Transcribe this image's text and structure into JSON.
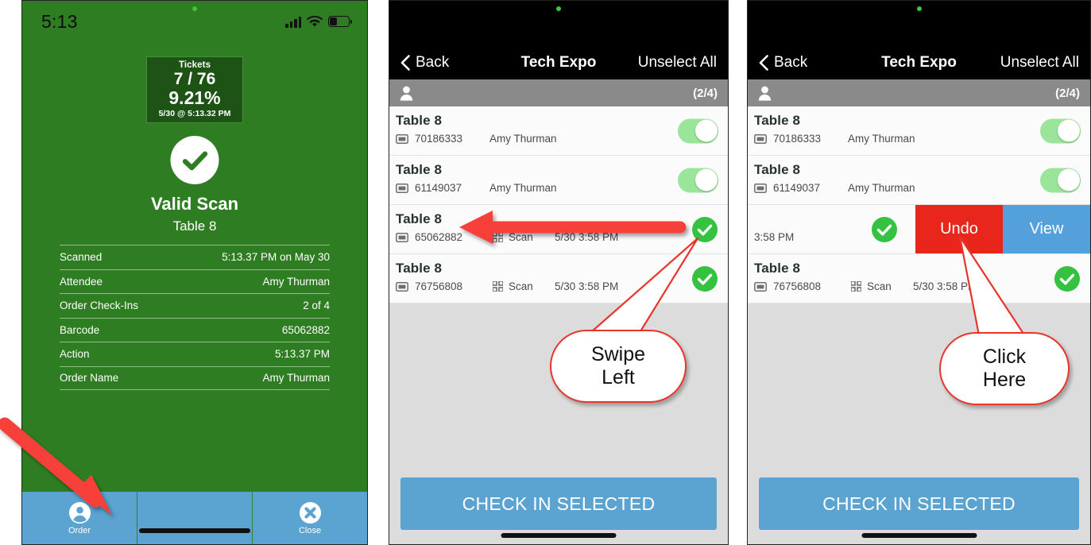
{
  "panel1": {
    "status": {
      "time": "5:13",
      "icons": [
        "cellular-icon",
        "wifi-icon",
        "battery-icon"
      ]
    },
    "ticket_box": {
      "label": "Tickets",
      "count": "7 / 76",
      "percent": "9.21%",
      "timestamp": "5/30 @ 5:13.32 PM"
    },
    "result": {
      "icon": "check-circle-icon",
      "title": "Valid Scan",
      "subtitle": "Table 8"
    },
    "details": [
      {
        "key": "Scanned",
        "value": "5:13.37 PM on May 30"
      },
      {
        "key": "Attendee",
        "value": "Amy Thurman"
      },
      {
        "key": "Order Check-Ins",
        "value": "2 of 4"
      },
      {
        "key": "Barcode",
        "value": "65062882"
      },
      {
        "key": "Action",
        "value": "5:13.37 PM"
      },
      {
        "key": "Order Name",
        "value": "Amy Thurman"
      }
    ],
    "tabbar": [
      {
        "icon": "person-circle-icon",
        "label": "Order"
      },
      {
        "icon": "",
        "label": ""
      },
      {
        "icon": "close-circle-icon",
        "label": "Close"
      }
    ],
    "colors": {
      "screen": "#2f7d22",
      "box": "#1d5415",
      "tabbar": "#5ba3d0"
    }
  },
  "panel2": {
    "nav": {
      "back": "Back",
      "title": "Tech Expo",
      "right": "Unselect All"
    },
    "subbar": {
      "icon": "person-icon",
      "count": "(2/4)"
    },
    "rows": [
      {
        "title": "Table 8",
        "barcode": "70186333",
        "name": "Amy Thurman",
        "scan": "",
        "time": "",
        "control": "toggle"
      },
      {
        "title": "Table 8",
        "barcode": "61149037",
        "name": "Amy Thurman",
        "scan": "",
        "time": "",
        "control": "toggle"
      },
      {
        "title": "Table 8",
        "barcode": "65062882",
        "name": "",
        "scan": "Scan",
        "time": "5/30 3:58 PM",
        "control": "check"
      },
      {
        "title": "Table 8",
        "barcode": "76756808",
        "name": "",
        "scan": "Scan",
        "time": "5/30 3:58 PM",
        "control": "check"
      }
    ],
    "cta": "CHECK IN SELECTED",
    "annotation": {
      "bubble": "Swipe\nLeft",
      "arrow": "left-arrow"
    }
  },
  "panel3": {
    "nav": {
      "back": "Back",
      "title": "Tech Expo",
      "right": "Unselect All"
    },
    "subbar": {
      "icon": "person-icon",
      "count": "(2/4)"
    },
    "rows": [
      {
        "title": "Table 8",
        "barcode": "70186333",
        "name": "Amy Thurman",
        "scan": "",
        "time": "",
        "control": "toggle"
      },
      {
        "title": "Table 8",
        "barcode": "61149037",
        "name": "Amy Thurman",
        "scan": "",
        "time": "",
        "control": "toggle"
      }
    ],
    "swiped_row": {
      "remnant_time": "3:58 PM",
      "undo": "Undo",
      "view": "View"
    },
    "last_row": {
      "title": "Table 8",
      "barcode": "76756808",
      "scan": "Scan",
      "time": "5/30 3:58 PM",
      "control": "check"
    },
    "cta": "CHECK IN SELECTED",
    "annotation": {
      "bubble": "Click\nHere"
    },
    "colors": {
      "undo": "#e8261c",
      "view": "#54a0db"
    }
  }
}
